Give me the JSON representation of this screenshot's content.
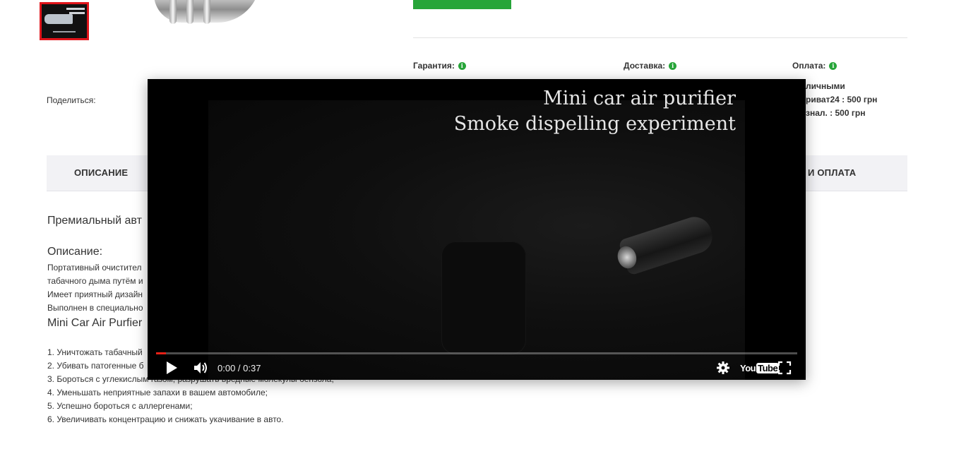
{
  "info": {
    "warranty_label": "Гарантия:",
    "delivery_label": "Доставка:",
    "payment_label": "Оплата:",
    "info_icon_glyph": "i",
    "payment_lines": [
      "личными",
      "риват24 : 500 грн",
      "знал. : 500 грн"
    ]
  },
  "share_label": "Поделиться:",
  "tabs": {
    "description": "ОПИСАНИЕ",
    "delivery_payment": "И ОПЛАТА"
  },
  "description": {
    "heading": "Премиальный авт",
    "subheading": "Описание:",
    "lines": [
      "Портативный очистител",
      "табачного дыма путём и",
      "Имеет приятный дизайн",
      "Выполнен в специально"
    ],
    "model_heading": "Mini Car Air Purfier",
    "features": [
      "1. Уничтожать табачный",
      "2. Убивать патогенные б",
      "3. Бороться с углекислым газом, разрушать вредные молекулы бензола;",
      "4. Уменьшать неприятные запахи в вашем автомобиле;",
      "5. Успешно бороться с аллергенами;",
      "6. Увеличивать концентрацию и снижать укачивание в авто."
    ]
  },
  "video": {
    "title_line1": "Mini car air purifier",
    "title_line2": "Smoke dispelling experiment",
    "time": "0:00 / 0:37",
    "progress_fraction": 0.015,
    "youtube_you": "You",
    "youtube_tube": "Tube"
  },
  "colors": {
    "accent_green": "#27a539",
    "thumb_border": "#e0151b",
    "progress_red": "#e62117"
  }
}
